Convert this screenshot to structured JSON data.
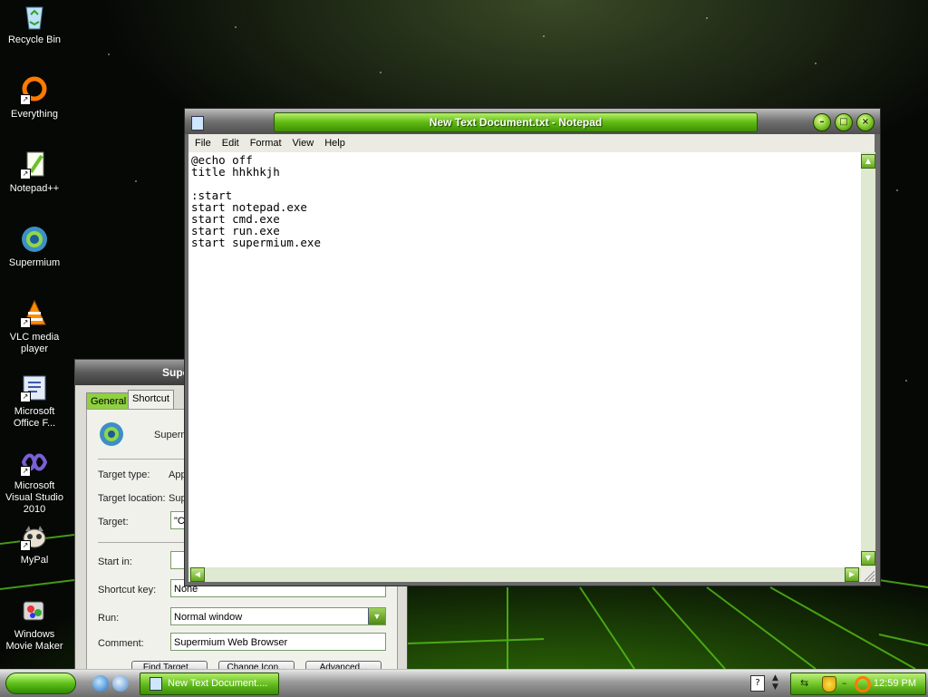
{
  "desktop": {
    "icons": [
      {
        "label": "Recycle Bin",
        "icon": "recycle-bin-icon"
      },
      {
        "label": "Everything",
        "icon": "everything-icon"
      },
      {
        "label": "Notepad++",
        "icon": "notepad-plus-plus-icon"
      },
      {
        "label": "Supermium",
        "icon": "supermium-icon"
      },
      {
        "label": "VLC media player",
        "icon": "vlc-icon"
      },
      {
        "label": "Microsoft Office F...",
        "icon": "office-icon"
      },
      {
        "label": "Microsoft Visual Studio 2010",
        "icon": "visual-studio-icon"
      },
      {
        "label": "MyPal",
        "icon": "mypal-icon"
      },
      {
        "label": "Windows Movie Maker",
        "icon": "movie-maker-icon"
      }
    ]
  },
  "notepad": {
    "title": "New Text Document.txt - Notepad",
    "menu": [
      "File",
      "Edit",
      "Format",
      "View",
      "Help"
    ],
    "content": "@echo off\ntitle hhkhkjh\n\n:start\nstart notepad.exe\nstart cmd.exe\nstart run.exe\nstart supermium.exe"
  },
  "properties": {
    "title": "Supe",
    "tabs": [
      "General",
      "Shortcut",
      "C"
    ],
    "app_name": "Superm",
    "rows": {
      "target_type_label": "Target type:",
      "target_type_value": "App",
      "target_location_label": "Target location:",
      "target_location_value": "Sup",
      "target_label": "Target:",
      "target_value": "\"C:",
      "start_in_label": "Start in:",
      "start_in_value": "",
      "shortcut_key_label": "Shortcut key:",
      "shortcut_key_value": "None",
      "run_label": "Run:",
      "run_value": "Normal window",
      "comment_label": "Comment:",
      "comment_value": "Supermium Web Browser"
    },
    "buttons": [
      "Find Target...",
      "Change Icon...",
      "Advanced..."
    ]
  },
  "taskbar": {
    "task_button": "New Text Document....",
    "clock": "12:59 PM"
  },
  "colors": {
    "accent_green": "#5fbb12",
    "chrome_gray": "#6f6f6f",
    "dialog_bg": "#f1f1ec"
  }
}
